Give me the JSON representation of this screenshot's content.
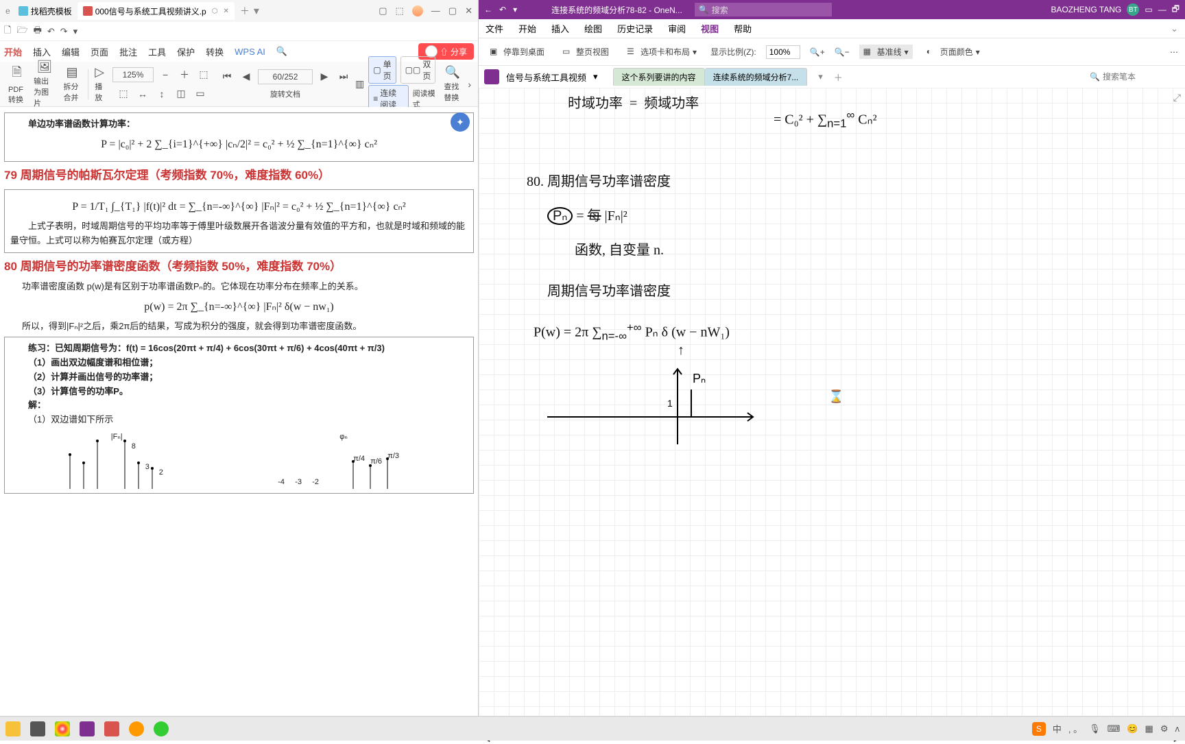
{
  "wps": {
    "tabs": [
      {
        "label": "找稻壳模板"
      },
      {
        "label": "000信号与系统工具视频讲义.p"
      }
    ],
    "qat": {
      "dropdown": "▾"
    },
    "menu": [
      "开始",
      "插入",
      "编辑",
      "页面",
      "批注",
      "工具",
      "保护",
      "转换"
    ],
    "ai_label": "WPS AI",
    "share": "分享",
    "ribbon": {
      "pdf_convert": "PDF转换",
      "export_img": "输出为图片",
      "split_merge": "拆分合并",
      "play": "播放",
      "zoom": "125%",
      "page": "60/252",
      "rotate": "旋转文档",
      "single": "单页",
      "double": "双页",
      "continuous": "连续阅读",
      "read_mode": "阅读模式",
      "find": "查找替换"
    },
    "doc": {
      "h1": "单边功率谱函数计算功率：",
      "f1": "P = |c₀|² + 2 ∑_{i=1}^{+∞} |cₙ/2|² = c₀² + ½ ∑_{n=1}^{∞} cₙ²",
      "h79": "79 周期信号的帕斯瓦尔定理（考频指数 70%，难度指数 60%）",
      "f79": "P = 1/T₁ ∫_{T₁} |f(t)|² dt = ∑_{n=-∞}^{∞} |Fₙ|² = c₀² + ½ ∑_{n=1}^{∞} cₙ²",
      "p79": "上式子表明，时域周期信号的平均功率等于傅里叶级数展开各谐波分量有效值的平方和，也就是时域和频域的能量守恒。上式可以称为帕赛瓦尔定理（或方程）",
      "h80": "80 周期信号的功率谱密度函数（考频指数 50%，难度指数 70%）",
      "p80a": "功率谱密度函数 p(w)是有区别于功率谱函数Pₙ的。它体现在功率分布在频率上的关系。",
      "f80": "p(w) = 2π ∑_{n=-∞}^{∞} |Fₙ|² δ(w − nw₁)",
      "p80b": "所以，得到|Fₙ|²之后，乘2π后的结果，写成为积分的强度，就会得到功率谱密度函数。",
      "ex_h": "练习：已知周期信号为：f(t) = 16cos(20πt + π/4) + 6cos(30πt + π/6) + 4cos(40πt + π/3)",
      "ex_q1": "（1）画出双边幅度谱和相位谱；",
      "ex_q2": "（2）计算并画出信号的功率谱；",
      "ex_q3": "（3）计算信号的功率P。",
      "ex_sol": "解：",
      "ex_a1": "（1）双边谱如下所示",
      "stem1_lbl": "|Fₙ|",
      "stem1_vals": [
        "8",
        "3",
        "2"
      ],
      "stem2_lbl": "φₙ",
      "stem2_vals": [
        "π/4",
        "π/6",
        "π/3"
      ],
      "stem_neg": [
        "-4",
        "-3",
        "-2"
      ]
    },
    "status": {
      "page": "60/252",
      "zoom": "125%"
    }
  },
  "onenote": {
    "back": "←",
    "undo": "↶",
    "title": "连接系统的频域分析78-82 - OneN...",
    "search_ph": "搜索",
    "username": "BAOZHENG TANG",
    "avatar": "BT",
    "menu": [
      "文件",
      "开始",
      "插入",
      "绘图",
      "历史记录",
      "审阅",
      "视图",
      "帮助"
    ],
    "active_menu": "视图",
    "ribbon": {
      "dock": "停靠到桌面",
      "full": "整页视图",
      "tabs_layout": "选项卡和布局",
      "scale_label": "显示比例(Z):",
      "scale_value": "100%",
      "grid": "基准线",
      "pagecolor": "页面颜色"
    },
    "notebook": "信号与系统工具视频",
    "sections": [
      "这个系列要讲的内容",
      "连续系统的频域分析7..."
    ],
    "notesearch_ph": "搜索笔本"
  },
  "taskbar": {
    "ime": "S",
    "lang": "中"
  }
}
